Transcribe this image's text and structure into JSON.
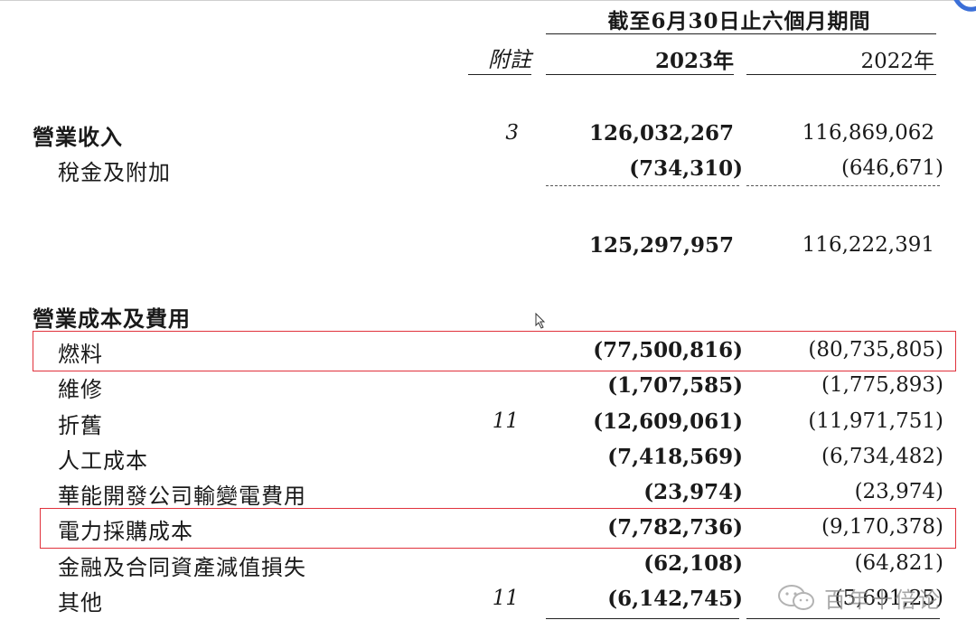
{
  "header": {
    "period": "截至6月30日止六個月期間",
    "note_label": "附註",
    "year_current": "2023年",
    "year_prior": "2022年"
  },
  "rows": [
    {
      "label": "營業收入",
      "note": "3",
      "v2023": "126,032,267",
      "v2022": "116,869,062"
    },
    {
      "label": "稅金及附加",
      "note": "",
      "v2023": "(734,310)",
      "v2022": "(646,671)"
    },
    {
      "label": "",
      "note": "",
      "v2023": "125,297,957",
      "v2022": "116,222,391"
    },
    {
      "label": "營業成本及費用",
      "note": "",
      "v2023": "",
      "v2022": ""
    },
    {
      "label": "燃料",
      "note": "",
      "v2023": "(77,500,816)",
      "v2022": "(80,735,805)"
    },
    {
      "label": "維修",
      "note": "",
      "v2023": "(1,707,585)",
      "v2022": "(1,775,893)"
    },
    {
      "label": "折舊",
      "note": "11",
      "v2023": "(12,609,061)",
      "v2022": "(11,971,751)"
    },
    {
      "label": "人工成本",
      "note": "",
      "v2023": "(7,418,569)",
      "v2022": "(6,734,482)"
    },
    {
      "label": "華能開發公司輸變電費用",
      "note": "",
      "v2023": "(23,974)",
      "v2022": "(23,974)"
    },
    {
      "label": "電力採購成本",
      "note": "",
      "v2023": "(7,782,736)",
      "v2022": "(9,170,378)"
    },
    {
      "label": "金融及合同資產減值損失",
      "note": "",
      "v2023": "(62,108)",
      "v2022": "(64,821)"
    },
    {
      "label": "其他",
      "note": "11",
      "v2023": "(6,142,745)",
      "v2022": "(5,691,25)"
    }
  ],
  "watermark": {
    "text": "百年十倍论",
    "icon": "wechat-icon"
  },
  "colors": {
    "highlight": "#e0323c",
    "text": "#1a1a1a"
  }
}
